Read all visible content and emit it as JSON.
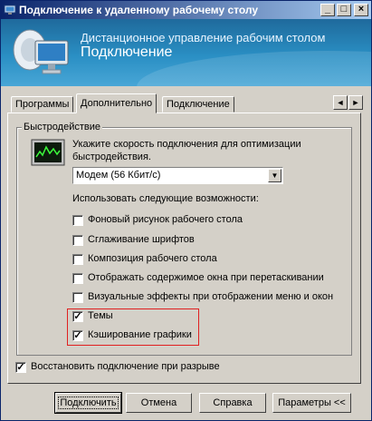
{
  "window": {
    "title": "Подключение к удаленному рабочему столу",
    "controls": {
      "minimize": "_",
      "maximize": "□",
      "close": "×"
    }
  },
  "banner": {
    "subtitle": "Дистанционное управление рабочим столом",
    "title": "Подключение"
  },
  "tabs": [
    {
      "label": "Программы",
      "active": false
    },
    {
      "label": "Дополнительно",
      "active": true
    },
    {
      "label": "Подключение",
      "active": false
    }
  ],
  "tab_scroll": {
    "left": "◄",
    "right": "►"
  },
  "performance": {
    "group_label": "Быстродействие",
    "prompt_line1": "Укажите скорость подключения для оптимизации",
    "prompt_line2": "быстродействия.",
    "speed_select": {
      "value": "Модем (56 Кбит/с)",
      "arrow": "▼"
    },
    "features_label": "Использовать следующие возможности:",
    "features": [
      {
        "label": "Фоновый рисунок рабочего стола",
        "checked": false
      },
      {
        "label": "Сглаживание шрифтов",
        "checked": false
      },
      {
        "label": "Композиция рабочего стола",
        "checked": false
      },
      {
        "label": "Отображать содержимое окна при перетаскивании",
        "checked": false
      },
      {
        "label": "Визуальные эффекты при отображении меню и окон",
        "checked": false
      },
      {
        "label": "Темы",
        "checked": true
      },
      {
        "label": "Кэширование графики",
        "checked": true
      }
    ]
  },
  "reconnect": {
    "label": "Восстановить подключение при разрыве",
    "checked": true
  },
  "buttons": {
    "connect": "Подключить",
    "cancel": "Отмена",
    "help": "Справка",
    "options": "Параметры <<"
  },
  "colors": {
    "title_start": "#0a246a",
    "title_end": "#a6caf0",
    "highlight": "#e02020",
    "face": "#d4d0c8"
  }
}
